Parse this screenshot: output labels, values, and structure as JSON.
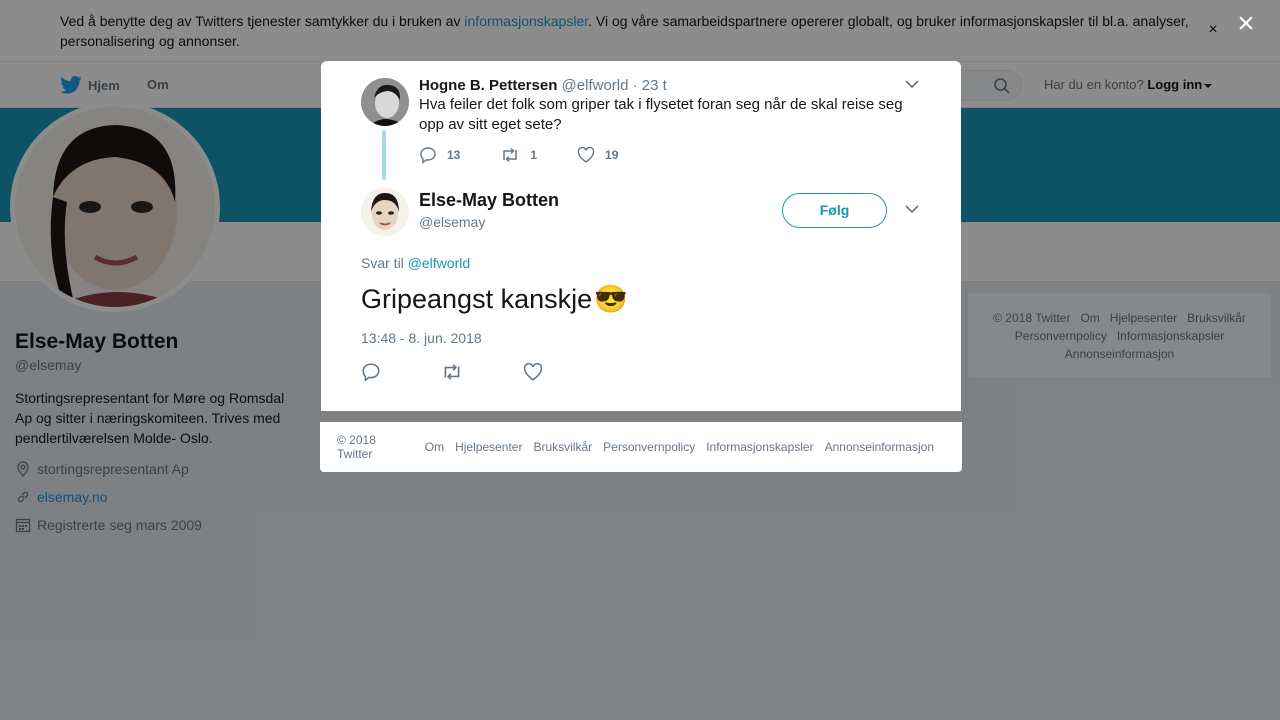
{
  "cookie": {
    "text_before": "Ved å benytte deg av Twitters tjenester samtykker du i bruken av ",
    "link": "informasjonskapsler",
    "text_after": ". Vi og våre samarbeidspartnere opererer globalt, og bruker informasjonskapsler til bl.a. analyser, personalisering og annonser.",
    "close": "×"
  },
  "nav": {
    "home": "Hjem",
    "about": "Om",
    "account_prompt": "Har du en konto?",
    "login": "Logg inn"
  },
  "profile": {
    "name": "Else-May Botten",
    "handle": "@elsemay",
    "bio": "Stortingsrepresentant for Møre og Romsdal Ap og sitter i næringskomiteen. Trives med pendlertilværelsen Molde- Oslo.",
    "location": "stortingsrepresentant Ap",
    "website": "elsemay.no",
    "joined": "Registrerte seg mars 2009"
  },
  "side_footer": [
    "© 2018 Twitter",
    "Om",
    "Hjelpesenter",
    "Bruksvilkår",
    "Personvernpolicy",
    "Informasjonskapsler",
    "Annonseinformasjon"
  ],
  "overlay_close": "×",
  "parent_tweet": {
    "name": "Hogne B. Pettersen",
    "handle": "@elfworld",
    "time": "· 23 t",
    "text": "Hva feiler det folk som griper tak i flysetet foran seg når de skal reise seg opp av sitt eget sete?",
    "replies": "13",
    "retweets": "1",
    "likes": "19"
  },
  "main_tweet": {
    "name": "Else-May Botten",
    "handle": "@elsemay",
    "follow": "Følg",
    "reply_prefix": "Svar til",
    "reply_to": "@elfworld",
    "text": "Gripeangst kanskje",
    "emoji": "😎",
    "timestamp": "13:48 - 8. jun. 2018"
  },
  "modal_footer": [
    "© 2018 Twitter",
    "Om",
    "Hjelpesenter",
    "Bruksvilkår",
    "Personvernpolicy",
    "Informasjonskapsler",
    "Annonseinformasjon"
  ],
  "colors": {
    "accent": "#1b95b8",
    "banner": "#1b95b8",
    "muted": "#657786"
  }
}
